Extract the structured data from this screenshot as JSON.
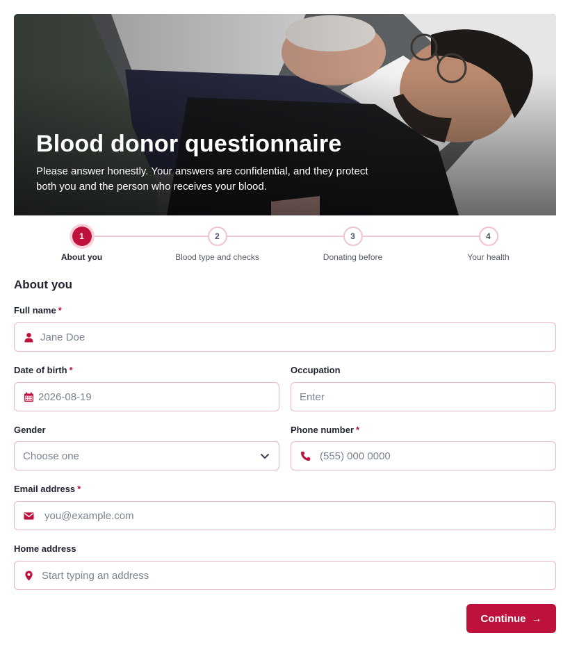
{
  "hero": {
    "title": "Blood donor questionnaire",
    "subtitle": "Please answer honestly. Your answers are confidential, and they protect both you and the person who receives your blood."
  },
  "stepper": {
    "steps": [
      {
        "number": "1",
        "label": "About you",
        "active": true
      },
      {
        "number": "2",
        "label": "Blood type and checks",
        "active": false
      },
      {
        "number": "3",
        "label": "Donating before",
        "active": false
      },
      {
        "number": "4",
        "label": "Your health",
        "active": false
      }
    ]
  },
  "form": {
    "section_title": "About you",
    "required_mark": "*",
    "full_name": {
      "label": "Full name",
      "placeholder": "Jane Doe",
      "icon": "user-icon"
    },
    "date_of_birth": {
      "label": "Date of birth",
      "placeholder": "2026-08-19",
      "icon": "calendar-icon"
    },
    "occupation": {
      "label": "Occupation",
      "placeholder": "Enter"
    },
    "gender": {
      "label": "Gender",
      "selected": "Choose one",
      "icon": "chevron-down-icon"
    },
    "phone": {
      "label": "Phone number",
      "placeholder": "(555) 000 0000",
      "icon": "phone-icon"
    },
    "email": {
      "label": "Email address",
      "placeholder": "you@example.com",
      "icon": "envelope-icon"
    },
    "home_address": {
      "label": "Home address",
      "placeholder": "Start typing an address",
      "icon": "map-pin-icon"
    },
    "continue_label": "Continue",
    "continue_arrow": "→"
  },
  "colors": {
    "accent": "#be123c",
    "field_border": "#e8b4c1",
    "step_ring": "#f0c2cc"
  }
}
